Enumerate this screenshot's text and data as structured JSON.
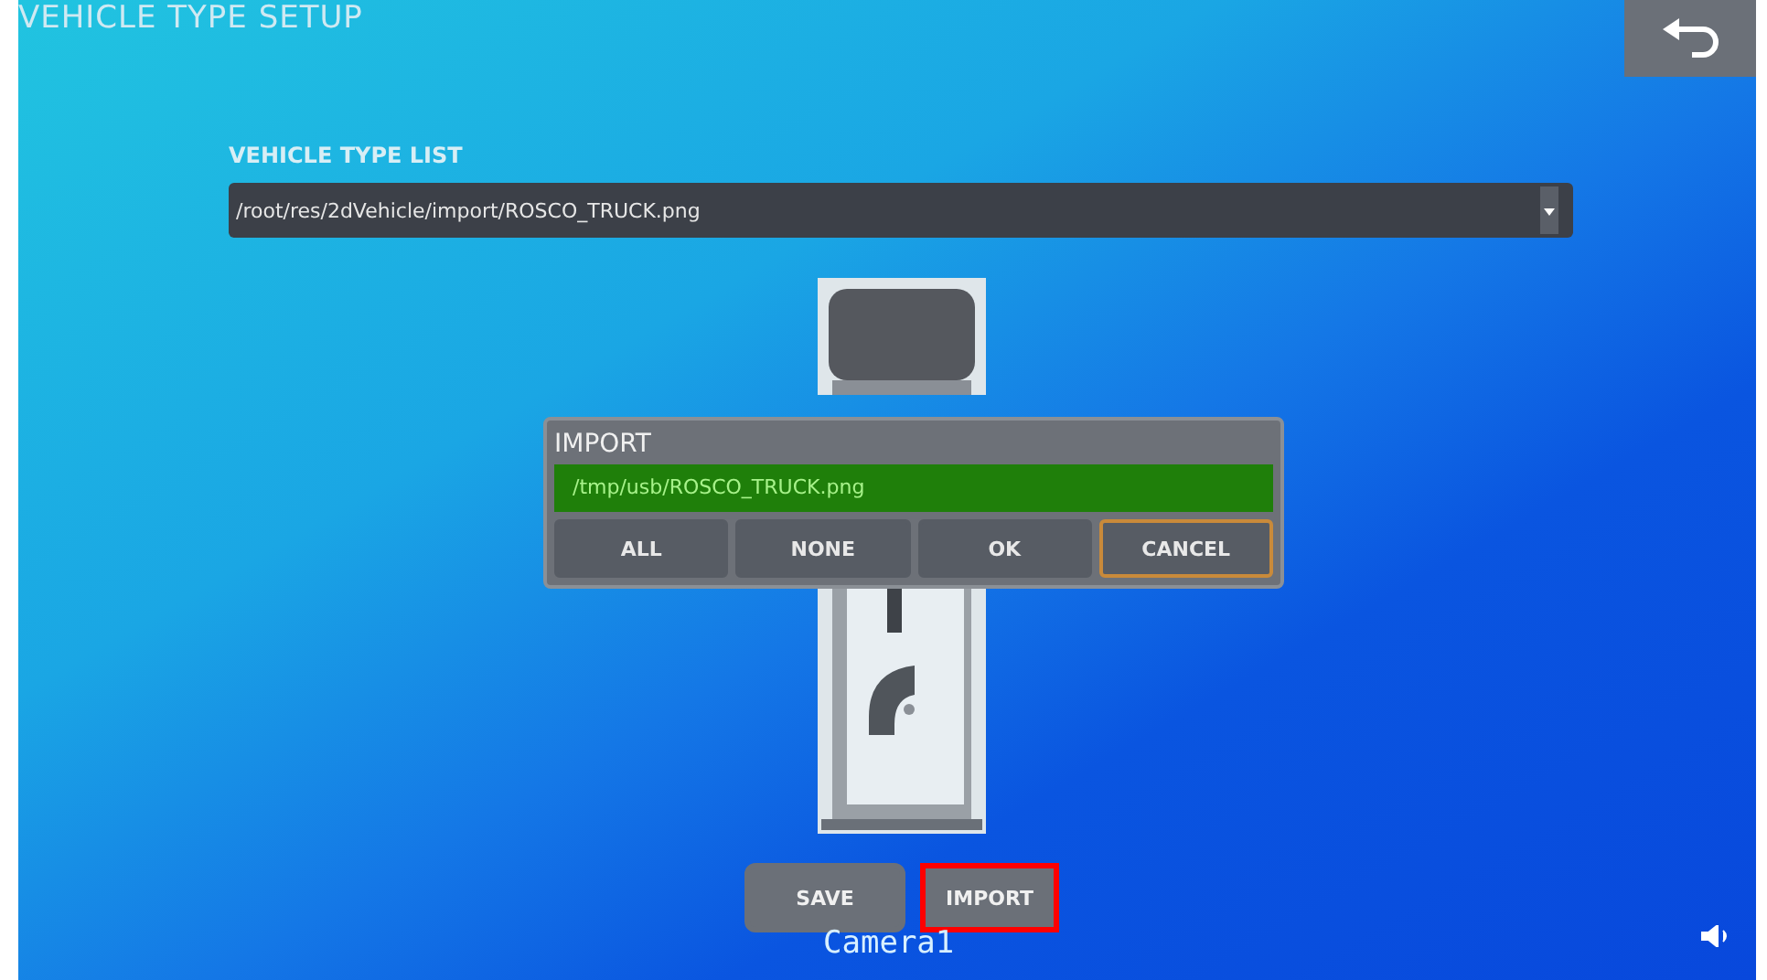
{
  "screen": {
    "title": "VEHICLE TYPE SETUP"
  },
  "vehicle_type_list": {
    "label": "VEHICLE TYPE LIST",
    "value": "/root/res/2dVehicle/import/ROSCO_TRUCK.png"
  },
  "import_dialog": {
    "title": "IMPORT",
    "files": [
      {
        "path": "/tmp/usb/ROSCO_TRUCK.png",
        "selected": true
      }
    ],
    "buttons": [
      {
        "label": "ALL",
        "focused": false
      },
      {
        "label": "NONE",
        "focused": false
      },
      {
        "label": "OK",
        "focused": false
      },
      {
        "label": "CANCEL",
        "focused": true
      }
    ]
  },
  "bottom_buttons": [
    {
      "label": "SAVE",
      "highlighted": false
    },
    {
      "label": "IMPORT",
      "highlighted": true
    }
  ],
  "camera_label": "Camera1"
}
